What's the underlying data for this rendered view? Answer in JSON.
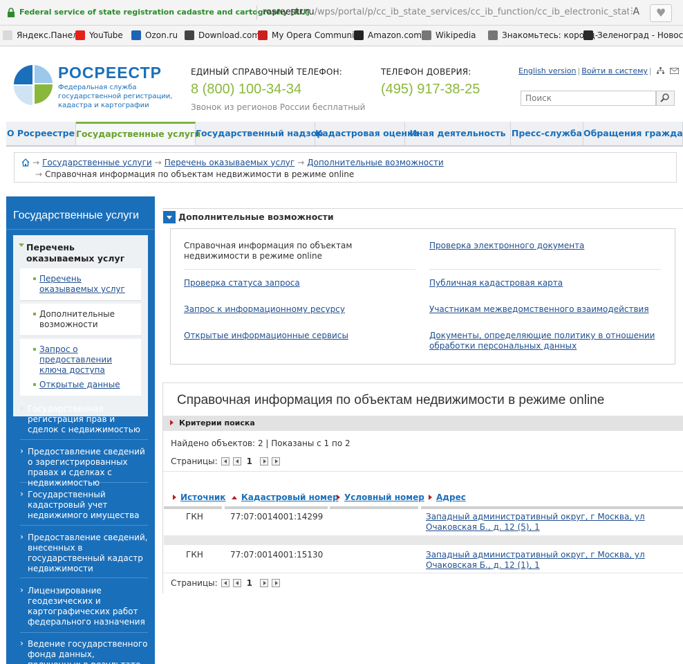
{
  "browser": {
    "site_name": "Federal service of state registration cadastre and cartography [RU]",
    "url_host": "rosreestr.ru",
    "url_path": "/wps/portal/p/cc_ib_state_services/cc_ib_function/cc_ib_electronic_state/online_rec",
    "reader_label": "⫶A",
    "bookmarks": [
      {
        "label": "Яндекс.Панель",
        "icon": "yandex-icon",
        "color": "#d9d9d9"
      },
      {
        "label": "YouTube",
        "icon": "youtube-icon",
        "color": "#e62117"
      },
      {
        "label": "Ozon.ru",
        "icon": "ozon-icon",
        "color": "#1d64b5"
      },
      {
        "label": "Download.com",
        "icon": "download-icon",
        "color": "#444444"
      },
      {
        "label": "My Opera Community",
        "icon": "opera-icon",
        "color": "#cc1f1f"
      },
      {
        "label": "Amazon.com",
        "icon": "amazon-icon",
        "color": "#222222"
      },
      {
        "label": "Wikipedia",
        "icon": "wikipedia-icon",
        "color": "#777777"
      },
      {
        "label": "Знакомьтесь: короед-",
        "icon": "page-icon",
        "color": "#777777"
      },
      {
        "label": "Зеленоград - Новост",
        "icon": "zelenograd-icon",
        "color": "#2a2a2a"
      }
    ]
  },
  "header": {
    "logo_name": "РОСРЕЕСТР",
    "logo_sub": [
      "Федеральная служба",
      "государственной регистрации,",
      "кадастра и картографии"
    ],
    "phone1_label": "ЕДИНЫЙ СПРАВОЧНЫЙ ТЕЛЕФОН:",
    "phone1": "8 (800) 100-34-34",
    "phone1_note": "Звонок из регионов России бесплатный",
    "phone2_label": "ТЕЛЕФОН ДОВЕРИЯ:",
    "phone2": "(495) 917-38-25",
    "english_link": "English version",
    "login_link": "Войти в систему",
    "search_placeholder": "Поиск"
  },
  "nav": {
    "tabs": [
      {
        "label": "О Росреестре",
        "active": false
      },
      {
        "label": "Государственные услуги",
        "active": true
      },
      {
        "label": "Государственный надзор",
        "active": false
      },
      {
        "label": "Кадастровая оценка",
        "active": false
      },
      {
        "label": "Иная деятельность",
        "active": false
      },
      {
        "label": "Пресс-служба",
        "active": false
      },
      {
        "label": "Обращения граждан",
        "active": false
      }
    ]
  },
  "breadcrumb": {
    "items": [
      "Государственные услуги",
      "Перечень оказываемых услуг",
      "Дополнительные возможности"
    ],
    "current": "Справочная информация по объектам недвижимости в режиме online"
  },
  "sidebar": {
    "heading": "Государственные услуги",
    "section_title": "Перечень оказываемых услуг",
    "sub_items": [
      {
        "label": "Перечень оказываемых услуг",
        "link": true
      },
      {
        "label": "Дополнительные возможности",
        "link": false
      },
      {
        "label": "Запрос о предоставлении ключа доступа",
        "link": true
      },
      {
        "label": "Открытые данные",
        "link": true
      }
    ],
    "items": [
      "Государственная регистрация прав и сделок с недвижимостью",
      "Предоставление сведений о зарегистрированных правах и сделках с недвижимостью",
      "Государственный кадастровый учет недвижимого имущества",
      "Предоставление сведений, внесенных в государственный кадастр недвижимости",
      "Лицензирование геодезических и картографических работ федерального назначения",
      "Ведение государственного фонда данных, полученных в результате землеустройства"
    ]
  },
  "extra": {
    "title": "Дополнительные возможности",
    "left": [
      {
        "label": "Справочная информация по объектам недвижимости в режиме online",
        "link": false
      },
      {
        "label": "Проверка статуса запроса",
        "link": true
      },
      {
        "label": "Запрос к информационному ресурсу",
        "link": true
      },
      {
        "label": "Открытые информационные сервисы",
        "link": true
      }
    ],
    "right": [
      {
        "label": "Проверка электронного документа",
        "link": true
      },
      {
        "label": "Публичная кадастровая карта",
        "link": true
      },
      {
        "label": "Участникам межведомственного взаимодействия",
        "link": true
      },
      {
        "label": "Документы, определяющие политику в отношении обработки персональных данных",
        "link": true
      }
    ]
  },
  "results": {
    "title": "Справочная информация по объектам недвижимости в режиме online",
    "criteria": "Критерии поиска",
    "found": "Найдено объектов: 2 | Показаны с 1 по 2",
    "pages_label": "Страницы:",
    "current_page": "1",
    "columns": [
      "Источник",
      "Кадастровый номер",
      "Условный номер",
      "Адрес"
    ],
    "rows": [
      {
        "source": "ГКН",
        "cadastral": "77:07:0014001:14299",
        "conditional": "",
        "address": "Западный административный округ, г Москва, ул Очаковская Б., д. 12 (5), 1"
      },
      {
        "source": "ГКН",
        "cadastral": "77:07:0014001:15130",
        "conditional": "",
        "address": "Западный административный округ, г Москва, ул Очаковская Б., д. 12 (1), 1"
      }
    ]
  }
}
